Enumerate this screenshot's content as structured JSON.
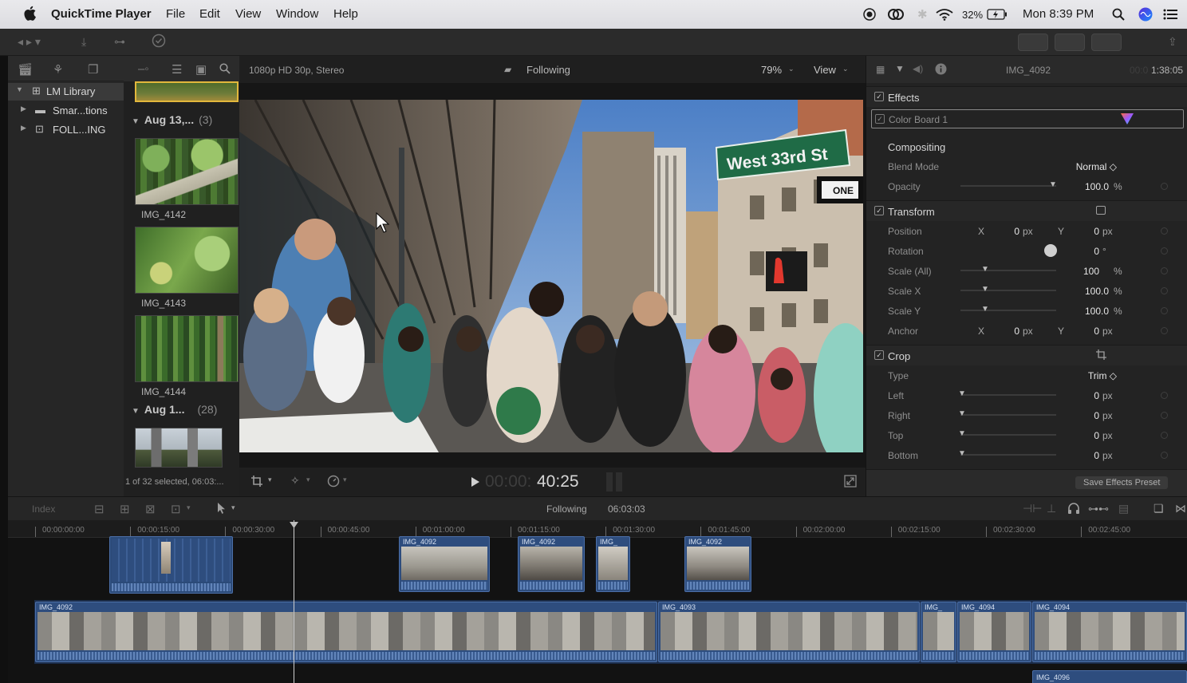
{
  "menubar": {
    "app_name": "QuickTime Player",
    "menus": [
      "File",
      "Edit",
      "View",
      "Window",
      "Help"
    ],
    "battery": "32%",
    "clock": "Mon 8:39 PM"
  },
  "library": {
    "items": [
      {
        "label": "LM Library",
        "icon": "library-icon",
        "selected": true
      },
      {
        "label": "Smar...tions",
        "icon": "folder-icon",
        "selected": false
      },
      {
        "label": "FOLL...ING",
        "icon": "event-icon",
        "selected": false
      }
    ]
  },
  "browser": {
    "groups": [
      {
        "label": "Aug 13,...",
        "count": "(3)"
      },
      {
        "label": "Aug 1...",
        "count": "(28)"
      }
    ],
    "clips": [
      "IMG_4142",
      "IMG_4143",
      "IMG_4144"
    ],
    "selection_status": "1 of 32 selected, 06:03:..."
  },
  "viewer": {
    "format": "1080p HD 30p, Stereo",
    "project_name": "Following",
    "zoom": "79%",
    "view_menu": "View",
    "timecode_dim": "00:00:",
    "timecode": "40:25",
    "street_sign_main": "West 33rd St",
    "street_sign_small": "ONE"
  },
  "inspector": {
    "clip_name": "IMG_4092",
    "duration_dim": "00:0",
    "duration": "1:38:05",
    "effects_label": "Effects",
    "color_board_label": "Color Board 1",
    "compositing_label": "Compositing",
    "blend_mode_label": "Blend Mode",
    "blend_mode_value": "Normal ◇",
    "opacity_label": "Opacity",
    "opacity_value": "100.0",
    "transform_label": "Transform",
    "position_label": "Position",
    "rotation_label": "Rotation",
    "scale_all_label": "Scale (All)",
    "scale_all_value": "100",
    "scale_x_label": "Scale X",
    "scale_x_value": "100.0",
    "scale_y_label": "Scale Y",
    "scale_y_value": "100.0",
    "anchor_label": "Anchor",
    "crop_label": "Crop",
    "type_label": "Type",
    "type_value": "Trim ◇",
    "left_label": "Left",
    "right_label": "Right",
    "top_label": "Top",
    "bottom_label": "Bottom",
    "x_label": "X",
    "y_label": "Y",
    "zero": "0",
    "px": "px",
    "percent": "%",
    "degree": "°",
    "save_preset": "Save Effects Preset"
  },
  "timeline": {
    "index_label": "Index",
    "project_name": "Following",
    "project_duration": "06:03:03",
    "ruler": [
      "00:00:00:00",
      "00:00:15:00",
      "00:00:30:00",
      "00:00:45:00",
      "00:01:00:00",
      "00:01:15:00",
      "00:01:30:00",
      "00:01:45:00",
      "00:02:00:00",
      "00:02:15:00",
      "00:02:30:00",
      "00:02:45:00"
    ],
    "connected_clips": [
      "IMG_4092",
      "IMG_4092",
      "IMG_",
      "IMG_4092"
    ],
    "primary_clips": [
      "IMG_4092",
      "IMG_4093",
      "IMG_",
      "IMG_4094",
      "IMG_4094"
    ],
    "lower_clip": "IMG_4096"
  },
  "colors": {
    "clip_blue": "#2e4d7e",
    "accent": "#3a86ff"
  }
}
